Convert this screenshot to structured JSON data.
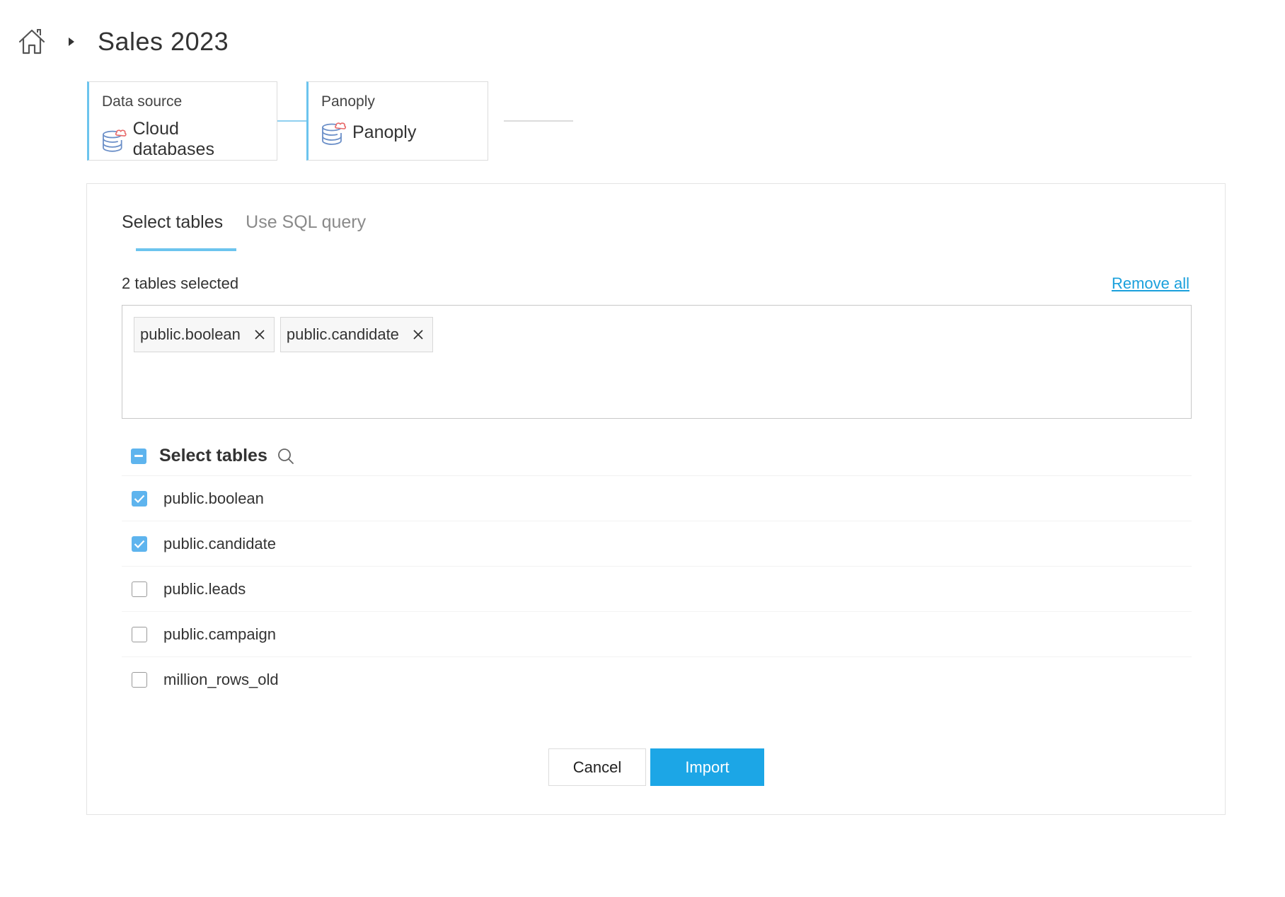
{
  "header": {
    "icons": {
      "home": "home-icon",
      "separator": "caret-right-icon"
    },
    "title": "Sales 2023"
  },
  "pipeline": {
    "steps": [
      {
        "label": "Data source",
        "value": "Cloud databases",
        "icon": "cloud-database-icon"
      },
      {
        "label": "Panoply",
        "value": "Panoply",
        "icon": "cloud-database-icon"
      }
    ]
  },
  "colors": {
    "accent": "#1ca6e6",
    "accent_light": "#6cc4ee",
    "checkbox": "#5eb4ee",
    "link": "#1aa0dc"
  },
  "tabs": [
    {
      "label": "Select tables",
      "active": true
    },
    {
      "label": "Use SQL query",
      "active": false
    }
  ],
  "selection": {
    "count_text": "2 tables selected",
    "remove_all_label": "Remove all",
    "chips": [
      "public.boolean",
      "public.candidate"
    ]
  },
  "table_list": {
    "title": "Select tables",
    "header_state": "indeterminate",
    "rows": [
      {
        "label": "public.boolean",
        "checked": true
      },
      {
        "label": "public.candidate",
        "checked": true
      },
      {
        "label": "public.leads",
        "checked": false
      },
      {
        "label": "public.campaign",
        "checked": false
      },
      {
        "label": "million_rows_old",
        "checked": false
      }
    ]
  },
  "actions": {
    "cancel_label": "Cancel",
    "import_label": "Import"
  }
}
